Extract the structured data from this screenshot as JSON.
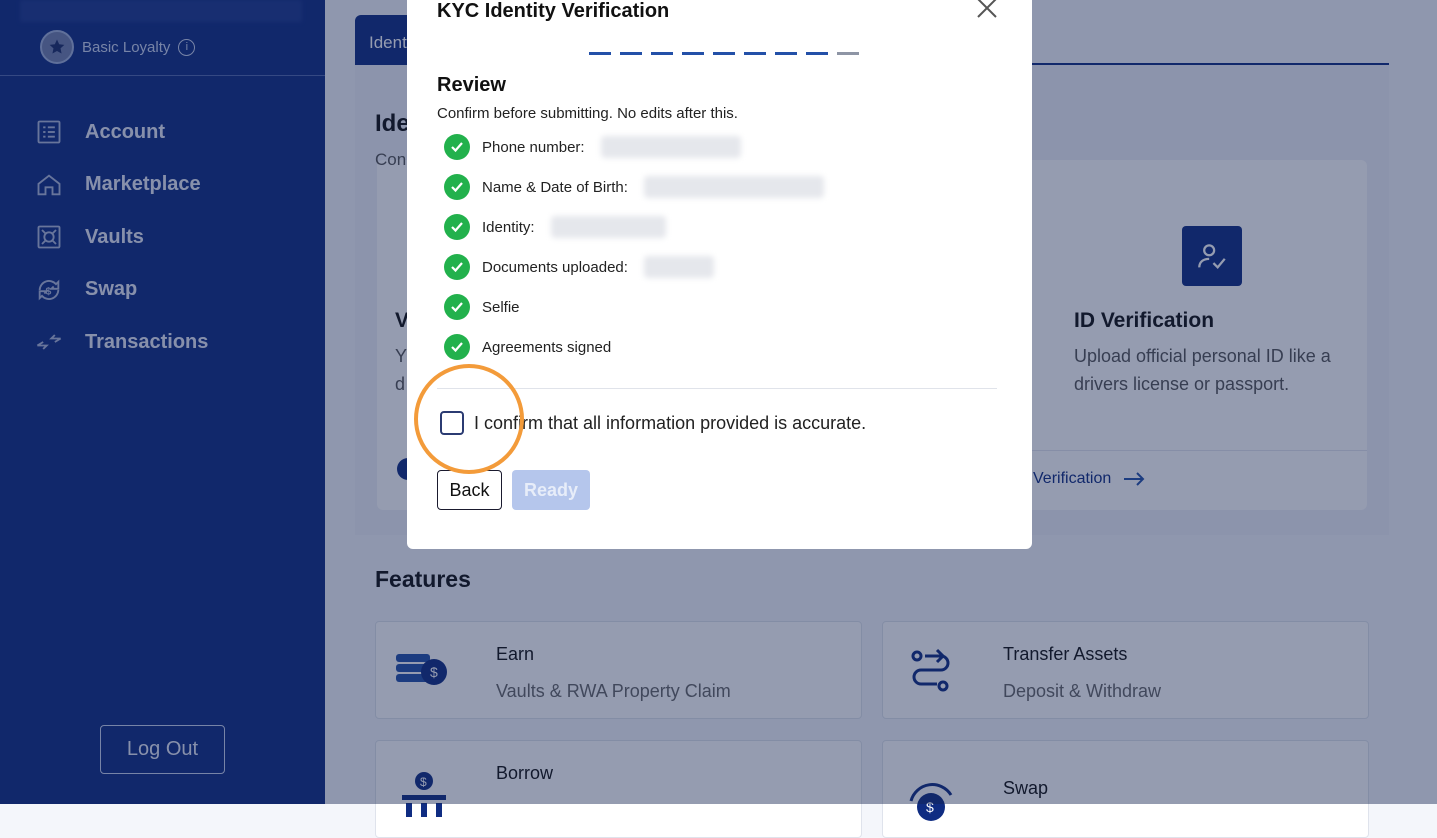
{
  "sidebar": {
    "loyalty_label": "Basic Loyalty",
    "info_glyph": "i",
    "items": [
      {
        "label": "Account",
        "icon": "list-icon"
      },
      {
        "label": "Marketplace",
        "icon": "home-icon"
      },
      {
        "label": "Vaults",
        "icon": "vault-icon"
      },
      {
        "label": "Swap",
        "icon": "swap-icon"
      },
      {
        "label": "Transactions",
        "icon": "transactions-icon"
      }
    ],
    "logout_label": "Log Out"
  },
  "main": {
    "tab_label": "Ident",
    "heading_partial": "Ide",
    "subtext_partial": "Con",
    "left_card_title_partial": "V",
    "left_card_desc_partial": "Y\nd",
    "id_verification": {
      "title": "ID Verification",
      "description": "Upload official personal ID like a drivers license or passport.",
      "link": "Verification"
    },
    "features_title": "Features",
    "features": [
      {
        "title": "Earn",
        "subtitle": "Vaults & RWA Property Claim",
        "icon": "coins-icon"
      },
      {
        "title": "Transfer Assets",
        "subtitle": "Deposit & Withdraw",
        "icon": "route-icon"
      },
      {
        "title": "Borrow",
        "subtitle": "",
        "icon": "bank-icon"
      },
      {
        "title": "Swap",
        "subtitle": "",
        "icon": "swap-coin-icon"
      }
    ]
  },
  "modal": {
    "title": "KYC Identity Verification",
    "step_count": 9,
    "current_step": 8,
    "section_title": "Review",
    "note": "Confirm before submitting. No edits after this.",
    "checks": [
      {
        "label": "Phone number:",
        "redacted": true
      },
      {
        "label": "Name & Date of Birth:",
        "redacted": true
      },
      {
        "label": "Identity:",
        "redacted": true
      },
      {
        "label": "Documents uploaded:",
        "redacted": true
      },
      {
        "label": "Selfie",
        "redacted": false
      },
      {
        "label": "Agreements signed",
        "redacted": false
      }
    ],
    "confirm_text": "I confirm that all information provided is accurate.",
    "back_label": "Back",
    "ready_label": "Ready"
  },
  "colors": {
    "sidebar": "#0f2c82",
    "accent": "#2350a8",
    "success": "#22b14c",
    "highlight": "#f39b3a",
    "disabled_button": "#b5c6ec"
  }
}
